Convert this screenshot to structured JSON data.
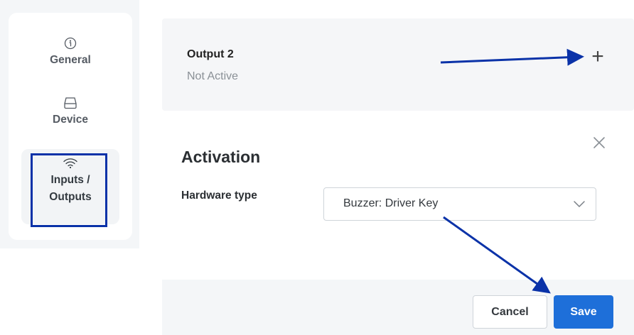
{
  "sidebar": {
    "items": [
      {
        "label": "General",
        "icon": "info-circle-icon"
      },
      {
        "label": "Device",
        "icon": "device-icon"
      },
      {
        "label": "Inputs /\nOutputs",
        "icon": "wifi-icon",
        "active": true
      }
    ]
  },
  "output": {
    "title": "Output 2",
    "status": "Not Active",
    "add_symbol": "+"
  },
  "activation": {
    "title": "Activation",
    "hardware_type_label": "Hardware type",
    "hardware_type_value": "Buzzer: Driver Key"
  },
  "footer": {
    "cancel_label": "Cancel",
    "save_label": "Save"
  },
  "colors": {
    "accent": "#1e6fd9",
    "annotation": "#0a32a8"
  }
}
